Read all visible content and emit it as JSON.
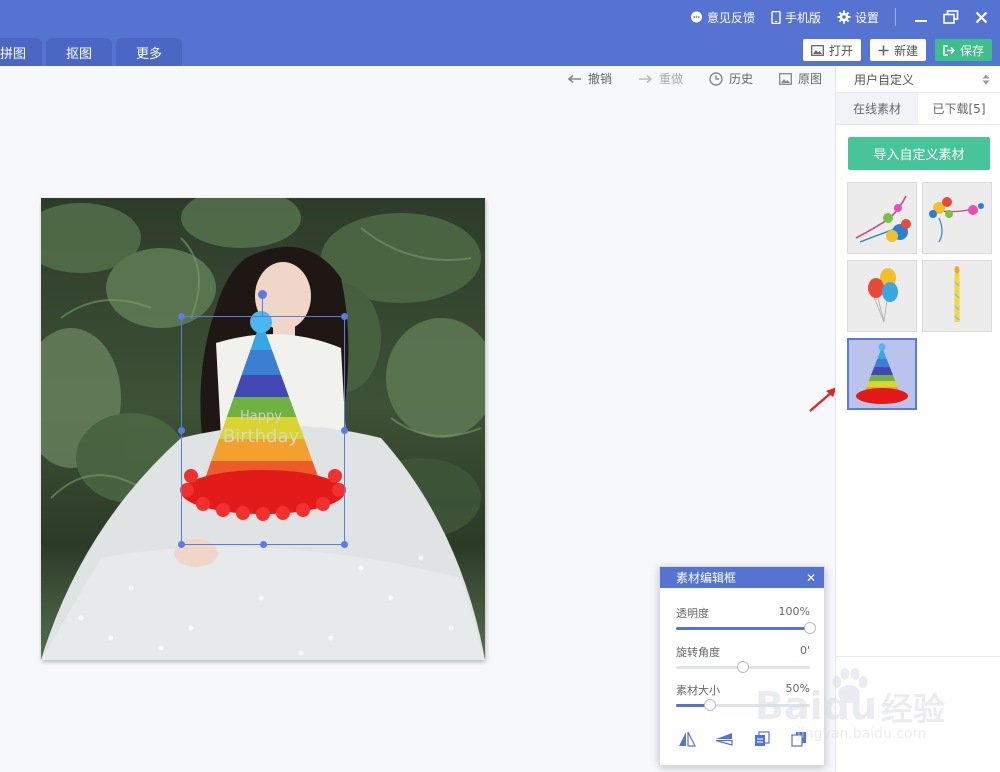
{
  "header": {
    "top_links": [
      {
        "label": "意见反馈",
        "icon": "feedback-icon"
      },
      {
        "label": "手机版",
        "icon": "phone-icon"
      },
      {
        "label": "设置",
        "icon": "gear-icon"
      }
    ],
    "tabs": [
      {
        "label": "拼图"
      },
      {
        "label": "抠图"
      },
      {
        "label": "更多"
      }
    ],
    "actions": {
      "open_label": "打开",
      "new_label": "新建",
      "save_label": "保存"
    }
  },
  "history_toolbar": {
    "undo_label": "撤销",
    "redo_label": "重做",
    "history_label": "历史",
    "original_label": "原图"
  },
  "panel": {
    "category_select": "用户自定义",
    "tabs": [
      {
        "label": "在线素材",
        "active": false
      },
      {
        "label": "已下载[5]",
        "active": true
      }
    ],
    "import_label": "导入自定义素材",
    "thumbnails": [
      {
        "name": "balloon-corner-left",
        "selected": false
      },
      {
        "name": "balloon-corner-right",
        "selected": false
      },
      {
        "name": "balloon-bunch",
        "selected": false
      },
      {
        "name": "birthday-candle",
        "selected": false
      },
      {
        "name": "party-hat",
        "selected": true
      }
    ]
  },
  "editor": {
    "title": "素材编辑框",
    "opacity_label": "透明度",
    "opacity_value": "100%",
    "opacity_level": 1.0,
    "rotation_label": "旋转角度",
    "rotation_value": "0'",
    "rotation_level": 0.5,
    "size_label": "素材大小",
    "size_value": "50%",
    "size_level": 0.25,
    "tools": [
      "flip-horizontal-icon",
      "flip-vertical-icon",
      "bring-forward-icon",
      "send-backward-icon"
    ]
  },
  "watermark": {
    "brand": "Baidu",
    "cn": "经验",
    "url": "jingyan.baidu.com"
  },
  "colors": {
    "header": "#5573d0",
    "green": "#3ebf8a",
    "selection": "#5d7ae0"
  }
}
